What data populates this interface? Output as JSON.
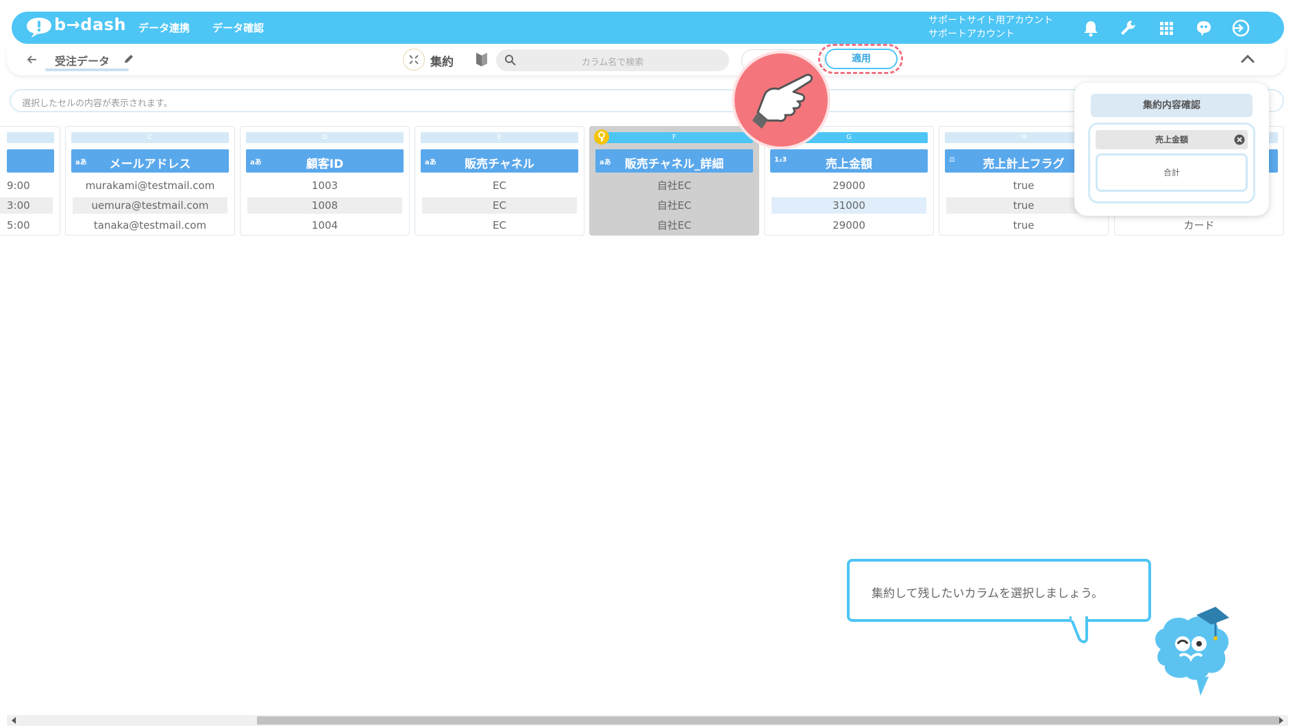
{
  "app": {
    "logo_text": "b→dash",
    "colors": {
      "brand": "#4dc5f5",
      "header_blue": "#5aa8ec",
      "alert": "#f07080",
      "key": "#f5c400"
    }
  },
  "nav": {
    "items": [
      "データ連携",
      "データ確認"
    ]
  },
  "account": {
    "line1": "サポートサイト用アカウント",
    "line2": "サポートアカウント"
  },
  "header_icons": [
    "bell-icon",
    "wrench-icon",
    "grid-icon",
    "mascot-icon",
    "logout-icon"
  ],
  "toolbar": {
    "table_name": "受注データ",
    "mode_label": "集約",
    "search_placeholder": "カラム名で検索",
    "apply_label": "適用"
  },
  "cellbar": {
    "placeholder": "選択したセルの内容が表示されます。"
  },
  "left_partial": {
    "cells": [
      "9:00",
      "3:00",
      "5:00"
    ]
  },
  "columns": [
    {
      "letter": "C",
      "type": "aあ",
      "name": "メールアドレス",
      "cells": [
        "murakami@testmail.com",
        "uemura@testmail.com",
        "tanaka@testmail.com"
      ]
    },
    {
      "letter": "D",
      "type": "aあ",
      "name": "顧客ID",
      "cells": [
        "1003",
        "1008",
        "1004"
      ]
    },
    {
      "letter": "E",
      "type": "aあ",
      "name": "販売チャネル",
      "cells": [
        "EC",
        "EC",
        "EC"
      ]
    },
    {
      "letter": "F",
      "type": "aあ",
      "name": "販売チャネル_詳細",
      "cells": [
        "自社EC",
        "自社EC",
        "自社EC"
      ],
      "selected": true,
      "key": true
    },
    {
      "letter": "G",
      "type": "1₂3",
      "name": "売上金額",
      "cells": [
        "29000",
        "31000",
        "29000"
      ]
    },
    {
      "letter": "H",
      "type": "⚖",
      "name": "売上計上フラグ",
      "cells": [
        "true",
        "true",
        "true"
      ]
    }
  ],
  "right_partial": {
    "cells": [
      "カード"
    ]
  },
  "agg_panel": {
    "title": "集約内容確認",
    "column": "売上金額",
    "function": "合計"
  },
  "tutorial": {
    "message": "集約して残したいカラムを選択しましょう。"
  }
}
